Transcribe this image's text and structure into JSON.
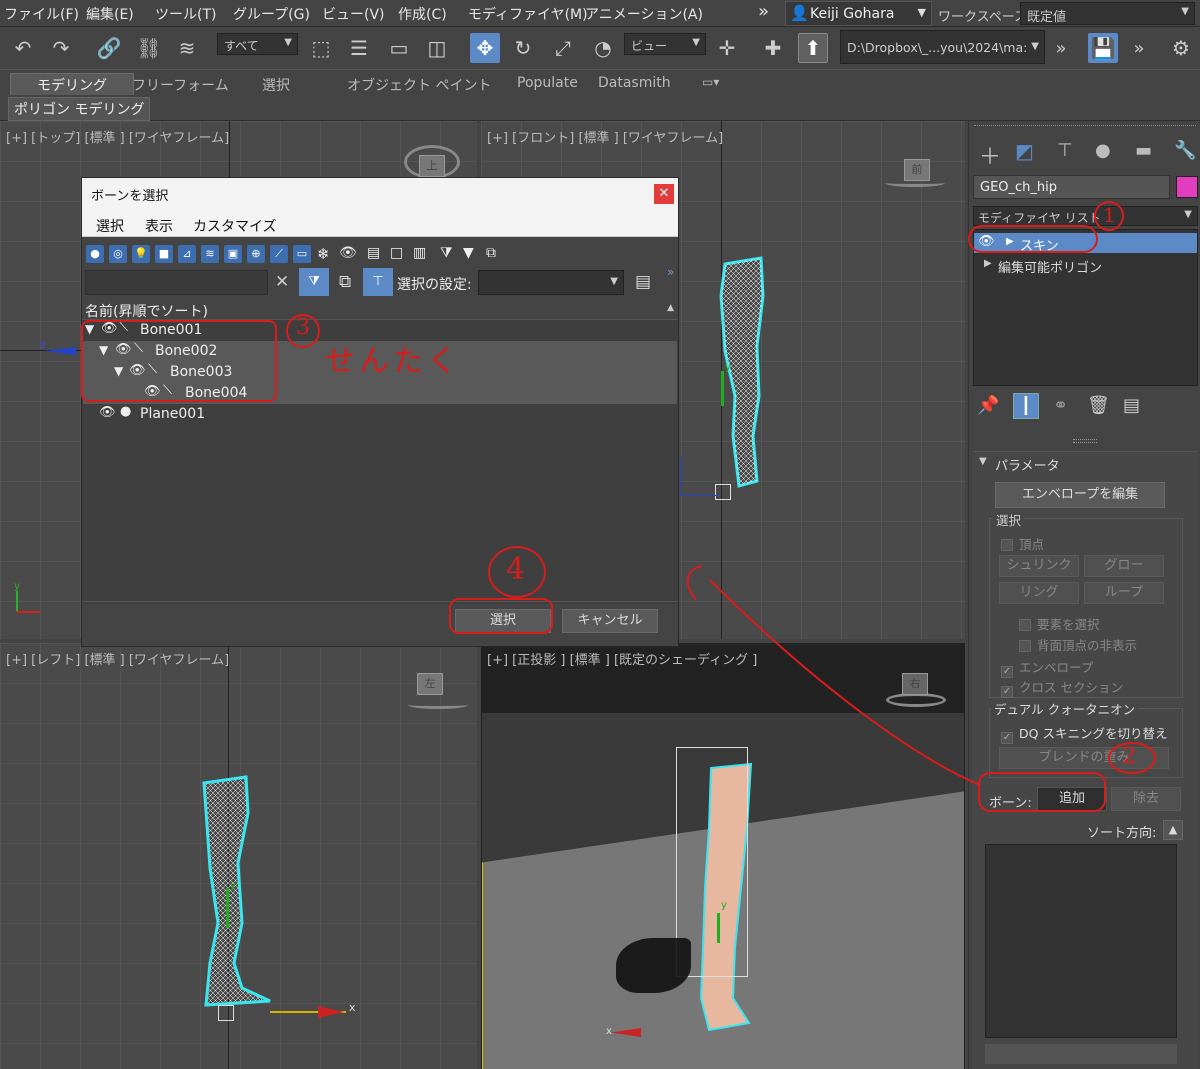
{
  "menu": [
    "ファイル(F)",
    "編集(E)",
    "ツール(T)",
    "グループ(G)",
    "ビュー(V)",
    "作成(C)",
    "モディファイヤ(M)",
    "アニメーション(A)"
  ],
  "menu_more": "»",
  "user": "Keiji Gohara",
  "workspace_label": "ワークスペース:",
  "workspace_value": "既定値",
  "toolbar": {
    "filter": "すべて",
    "refcoord": "ビュー",
    "path": "D:\\Dropbox\\_...you\\2024\\ma:"
  },
  "ribbon_tabs": [
    "モデリング",
    "フリーフォーム",
    "選択",
    "オブジェクト ペイント",
    "Populate",
    "Datasmith"
  ],
  "subribbon": "ポリゴン モデリング",
  "viewports": {
    "top": "[+] [トップ] [標準 ] [ワイヤフレーム]",
    "front": "[+] [フロント] [標準 ] [ワイヤフレーム]",
    "left": "[+] [レフト] [標準 ] [ワイヤフレーム]",
    "persp": "[+] [正投影 ] [標準 ] [既定のシェーディング ]",
    "cube_front": "前",
    "cube_left": "左",
    "cube_top": "上",
    "cube_persp": "右"
  },
  "axes": {
    "x": "x",
    "y": "y",
    "z": "z"
  },
  "dialog": {
    "title": "ボーンを選択",
    "menu": [
      "選択",
      "表示",
      "カスタマイズ"
    ],
    "sel_set_label": "選択の設定:",
    "column": "名前(昇順でソート)",
    "rows": [
      "Bone001",
      "Bone002",
      "Bone003",
      "Bone004",
      "Plane001"
    ],
    "select_btn": "選択",
    "cancel_btn": "キャンセル"
  },
  "panel": {
    "object_name": "GEO_ch_hip",
    "modlist": "モディファイヤ リスト",
    "stack": [
      "スキン",
      "編集可能ポリゴン"
    ],
    "params": "パラメータ",
    "edit_env": "エンベロープを編集",
    "sel_group": "選択",
    "vertex": "頂点",
    "shrink": "シュリンク",
    "grow": "グロー",
    "ring": "リング",
    "loop": "ループ",
    "sel_elem": "要素を選択",
    "backface": "背面頂点の非表示",
    "envelope": "エンベロープ",
    "cross": "クロス セクション",
    "dq_group": "デュアル クォータニオン",
    "dq_toggle": "DQ スキニングを切り替え",
    "blend": "ブレンドの重み",
    "bones_label": "ボーン:",
    "add": "追加",
    "remove": "除去",
    "sort": "ソート方向:"
  },
  "annotations": {
    "n1": "1",
    "n2": "2",
    "n3": "3",
    "n3_text": "せんたく",
    "n4": "4"
  },
  "colors": {
    "accent": "#5b8ac6",
    "annotation": "#d91c1c",
    "mesh": "#39e6f0",
    "skin": "#e8b7a0"
  }
}
